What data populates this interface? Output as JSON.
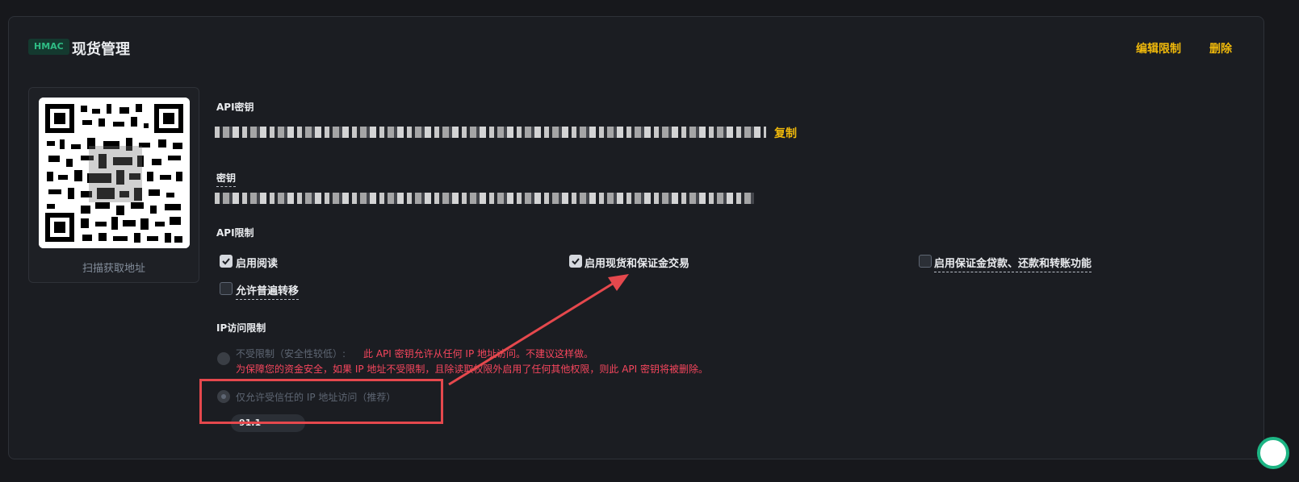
{
  "header": {
    "badge": "HMAC",
    "title": "现货管理",
    "edit_label": "编辑限制",
    "delete_label": "删除"
  },
  "qr": {
    "caption": "扫描获取地址"
  },
  "api_key": {
    "label": "API密钥",
    "copy_label": "复制"
  },
  "secret_key": {
    "label": "密钥"
  },
  "api_restrictions": {
    "label": "API限制",
    "options": [
      {
        "label": "启用阅读",
        "checked": true
      },
      {
        "label": "启用现货和保证金交易",
        "checked": true
      },
      {
        "label": "启用保证金贷款、还款和转账功能",
        "checked": false
      },
      {
        "label": "允许普遍转移",
        "checked": false
      }
    ]
  },
  "ip_restrictions": {
    "label": "IP访问限制",
    "unrestricted_label": "不受限制（安全性较低）:",
    "warning_line1": "此 API 密钥允许从任何 IP 地址访问。不建议这样做。",
    "warning_line2": "为保障您的资金安全，如果 IP 地址不受限制，且除读取权限外启用了任何其他权限，则此 API 密钥将被删除。",
    "trusted_label": "仅允许受信任的 IP 地址访问（推荐）",
    "ip_value": "91.1"
  },
  "colors": {
    "accent": "#f0b90b",
    "danger": "#f6465d",
    "annotation": "#e5484d",
    "badge_green": "#2fbd85"
  }
}
